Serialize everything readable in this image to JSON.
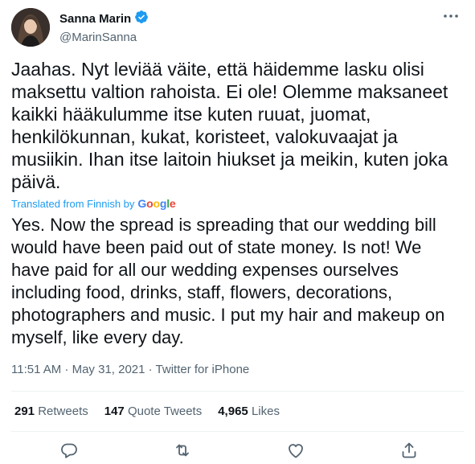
{
  "author": {
    "display_name": "Sanna Marin",
    "handle": "@MarinSanna",
    "verified": true
  },
  "tweet": {
    "text": "Jaahas. Nyt leviää väite, että häidemme lasku olisi\nmaksettu valtion rahoista. Ei ole! Olemme maksaneet\nkaikki hääkulumme itse kuten ruuat, juomat,\nhenkilökunnan, kukat, koristeet, valokuvaajat ja\nmusiikin. Ihan itse laitoin hiukset ja meikin, kuten joka\npäivä.",
    "translated_label": "Translated from Finnish by",
    "translation_provider": "Google",
    "translation": "Yes. Now the spread is spreading that our wedding bill\nwould have been paid out of state money. Is not! We\nhave paid for all our wedding expenses ourselves\nincluding food, drinks, staff, flowers, decorations,\nphotographers and music. I put my hair and makeup on\nmyself, like every day.",
    "timestamp": "11:51 AM · May 31, 2021 · Twitter for iPhone"
  },
  "stats": {
    "retweets_count": "291",
    "retweets_label": "Retweets",
    "quotes_count": "147",
    "quotes_label": "Quote Tweets",
    "likes_count": "4,965",
    "likes_label": "Likes"
  },
  "icons": {
    "verified": "verified-badge-icon",
    "more": "more-icon",
    "reply": "reply-icon",
    "retweet": "retweet-icon",
    "like": "like-icon",
    "share": "share-icon"
  },
  "colors": {
    "accent": "#1d9bf0",
    "text": "#0f1419",
    "secondary": "#536471",
    "divider": "#eff3f4"
  }
}
